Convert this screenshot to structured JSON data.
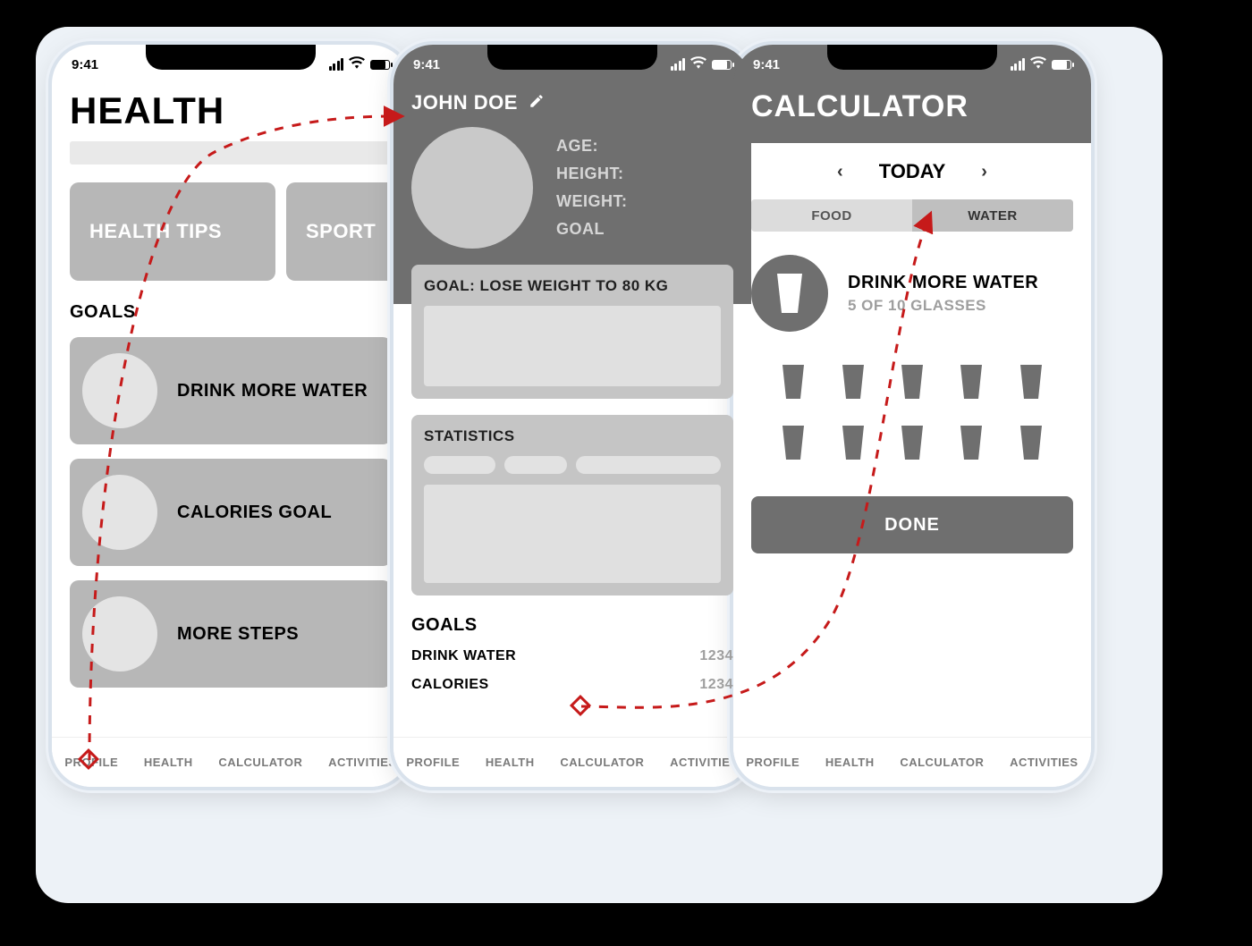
{
  "status_time": "9:41",
  "nav": {
    "profile": "PROFILE",
    "health": "HEALTH",
    "calculator": "CALCULATOR",
    "activities": "ACTIVITIES"
  },
  "screen1": {
    "title": "HEALTH",
    "tile1": "HEALTH TIPS",
    "tile2": "SPORT",
    "goals_label": "GOALS",
    "goal1": "DRINK MORE WATER",
    "goal2": "CALORIES GOAL",
    "goal3": "MORE STEPS"
  },
  "screen2": {
    "name": "JOHN DOE",
    "fact_age": "AGE:",
    "fact_height": "HEIGHT:",
    "fact_weight": "WEIGHT:",
    "fact_goal": "GOAL",
    "goal_panel": "GOAL: LOSE WEIGHT TO 80 KG",
    "stats_panel": "STATISTICS",
    "goals_label": "GOALS",
    "g1_label": "DRINK WATER",
    "g1_value": "1234",
    "g2_label": "CALORIES",
    "g2_value": "1234"
  },
  "screen3": {
    "title": "CALCULATOR",
    "date_label": "TODAY",
    "seg_food": "FOOD",
    "seg_water": "WATER",
    "summary_title": "DRINK MORE WATER",
    "summary_sub": "5 OF 10 GLASSES",
    "done": "DONE"
  }
}
